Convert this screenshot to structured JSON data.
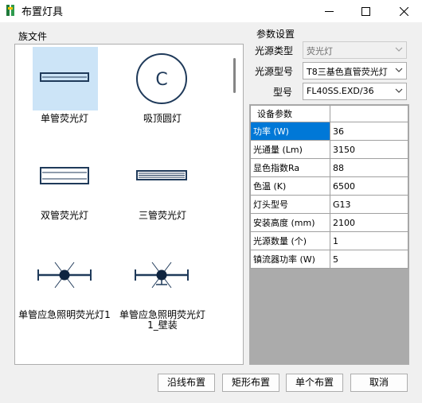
{
  "window": {
    "title": "布置灯具"
  },
  "family_panel": {
    "label": "族文件",
    "items": [
      {
        "label": "单管荧光灯",
        "icon": "single-tube-fluorescent-icon",
        "selected": true
      },
      {
        "label": "吸顶圆灯",
        "icon": "ceiling-round-lamp-icon",
        "symbol": "C"
      },
      {
        "label": "双管荧光灯",
        "icon": "double-tube-fluorescent-icon"
      },
      {
        "label": "三管荧光灯",
        "icon": "triple-tube-fluorescent-icon"
      },
      {
        "label": "单管应急照明荧光灯1",
        "icon": "emergency-fluorescent-icon"
      },
      {
        "label_line1": "单管应急照明荧光灯",
        "label_line2": "1_壁装",
        "icon": "emergency-fluorescent-wall-icon"
      }
    ]
  },
  "params": {
    "group_label": "参数设置",
    "light_type_label": "光源类型",
    "light_type_value": "荧光灯",
    "light_model_label": "光源型号",
    "light_model_value": "T8三基色直管荧光灯",
    "model_label": "型号",
    "model_value": "FL40SS.EXD/36"
  },
  "device_params": {
    "header": "设备参数",
    "rows": [
      {
        "key": "功率 (W)",
        "value": "36"
      },
      {
        "key": "光通量 (Lm)",
        "value": "3150"
      },
      {
        "key": "显色指数Ra",
        "value": "88"
      },
      {
        "key": "色温 (K)",
        "value": "6500"
      },
      {
        "key": "灯头型号",
        "value": "G13"
      },
      {
        "key": "安装高度 (mm)",
        "value": "2100"
      },
      {
        "key": "光源数量 (个)",
        "value": "1"
      },
      {
        "key": "镇流器功率 (W)",
        "value": "5"
      }
    ]
  },
  "buttons": {
    "along_line": "沿线布置",
    "rectangle": "矩形布置",
    "single": "单个布置",
    "cancel": "取消"
  },
  "colors": {
    "accent": "#0078d7",
    "selection": "#cce4f7",
    "symbol_stroke": "#1f3a5a"
  }
}
